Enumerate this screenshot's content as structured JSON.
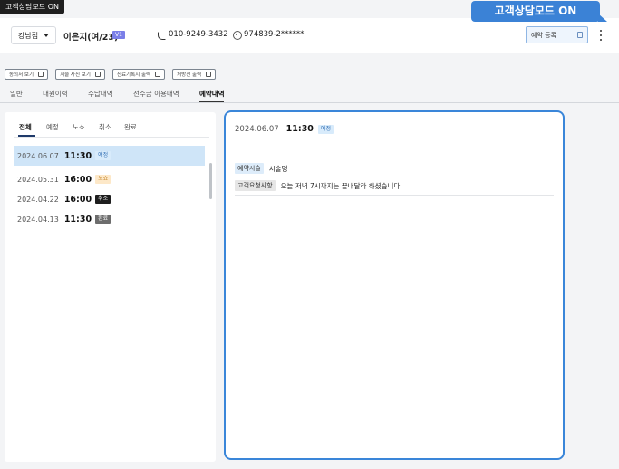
{
  "mode_badge": "고객상담모드 ON",
  "consult_tooltip": "고객상담모드 ON",
  "header": {
    "branch": "강남점",
    "patient_name": "이은지(여/23)",
    "tier": "V1",
    "phone": "010-9249-3432",
    "rrn": "974839-2******",
    "book_button": "예약 등록"
  },
  "actions": [
    "동의서 보기",
    "시술 사진 보기",
    "진료기록지 출력",
    "처방전 출력"
  ],
  "tabs": [
    {
      "label": "일반",
      "active": false
    },
    {
      "label": "내원이력",
      "active": false
    },
    {
      "label": "수납내역",
      "active": false
    },
    {
      "label": "선수금 이용내역",
      "active": false
    },
    {
      "label": "예약내역",
      "active": true
    }
  ],
  "subtabs": [
    {
      "label": "전체",
      "active": true
    },
    {
      "label": "예정",
      "active": false
    },
    {
      "label": "노쇼",
      "active": false
    },
    {
      "label": "취소",
      "active": false
    },
    {
      "label": "완료",
      "active": false
    }
  ],
  "appointments": [
    {
      "date": "2024.06.07",
      "time": "11:30",
      "status": "예정",
      "selected": true
    },
    {
      "date": "2024.05.31",
      "time": "16:00",
      "status": "노쇼",
      "selected": false
    },
    {
      "date": "2024.04.22",
      "time": "16:00",
      "status": "취소",
      "selected": false
    },
    {
      "date": "2024.04.13",
      "time": "11:30",
      "status": "완료",
      "selected": false
    }
  ],
  "detail": {
    "date": "2024.06.07",
    "time": "11:30",
    "status": "예정",
    "procedure_label": "예약시술",
    "procedure_value": "시술명",
    "request_label": "고객요청사항",
    "request_value": "오늘 저녁 7시까지는 끝내달라 하셨습니다."
  }
}
